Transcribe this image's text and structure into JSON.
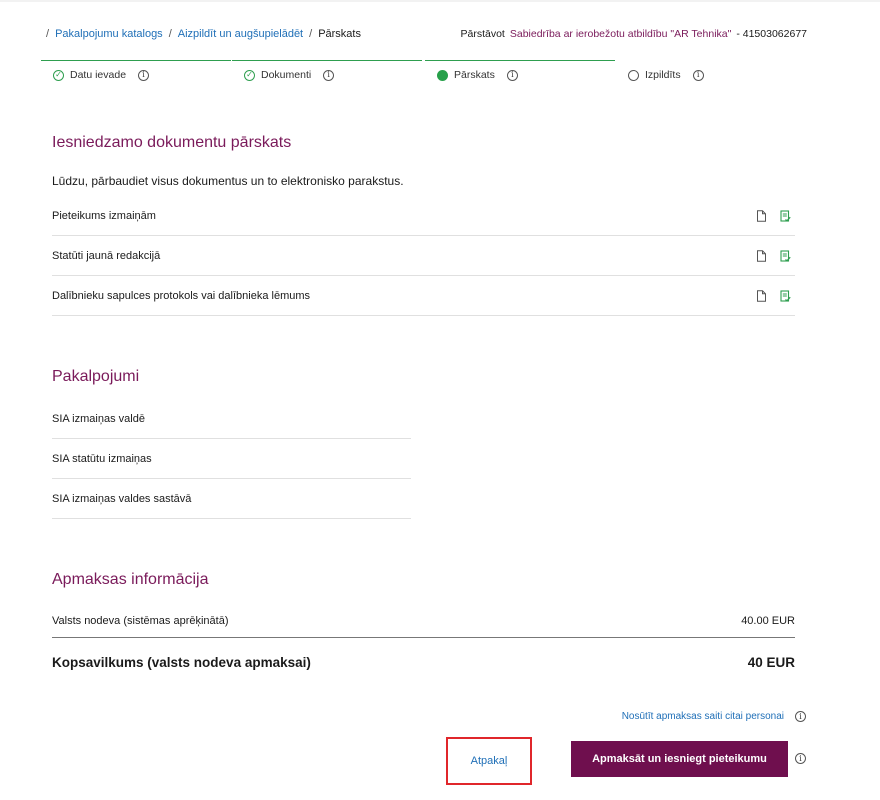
{
  "breadcrumb": {
    "items": [
      "Pakalpojumu katalogs",
      "Aizpildīt un augšupielādēt"
    ],
    "current": "Pārskats",
    "separator": "/"
  },
  "representative": {
    "label": "Pārstāvot",
    "name": "Sabiedrība ar ierobežotu atbildību \"AR Tehnika\"",
    "code": "- 41503062677"
  },
  "stepper": {
    "steps": [
      {
        "label": "Datu ievade",
        "state": "done"
      },
      {
        "label": "Dokumenti",
        "state": "done"
      },
      {
        "label": "Pārskats",
        "state": "active"
      },
      {
        "label": "Izpildīts",
        "state": "todo"
      }
    ]
  },
  "documents": {
    "title": "Iesniedzamo dokumentu pārskats",
    "instruction": "Lūdzu, pārbaudiet visus dokumentus un to elektronisko parakstus.",
    "items": [
      {
        "label": "Pieteikums izmaiņām"
      },
      {
        "label": "Statūti jaunā redakcijā"
      },
      {
        "label": "Dalībnieku sapulces protokols vai dalībnieka lēmums"
      }
    ]
  },
  "services": {
    "title": "Pakalpojumi",
    "items": [
      {
        "label": "SIA izmaiņas valdē"
      },
      {
        "label": "SIA statūtu izmaiņas"
      },
      {
        "label": "SIA izmaiņas valdes sastāvā"
      }
    ]
  },
  "payment": {
    "title": "Apmaksas informācija",
    "fee_label": "Valsts nodeva (sistēmas aprēķinātā)",
    "fee_value": "40.00 EUR",
    "total_label": "Kopsavilkums (valsts nodeva apmaksai)",
    "total_value": "40 EUR"
  },
  "actions": {
    "send_link": "Nosūtīt apmaksas saiti citai personai",
    "back": "Atpakaļ",
    "pay_submit": "Apmaksāt un iesniegt pieteikumu"
  },
  "colors": {
    "accent": "#7a1a5a",
    "primary_button": "#6f0f4e",
    "link": "#1f6fb7",
    "step_done": "#2e9e4f",
    "highlight_border": "#e0262b"
  }
}
